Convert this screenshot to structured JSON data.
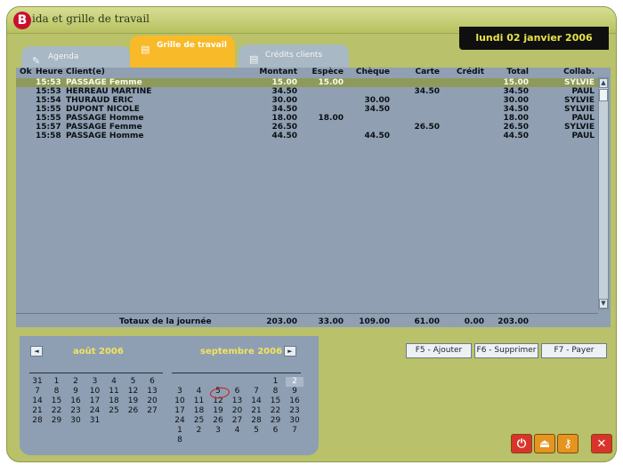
{
  "window": {
    "title": "Agenda et grille de travail",
    "visible_title": "ida et grille de travail",
    "logo_letter": "B"
  },
  "date_display": "lundi 02 janvier 2006",
  "tabs": [
    {
      "label": "Agenda",
      "icon": "agenda-icon"
    },
    {
      "label": "Grille de travail",
      "icon": "grid-icon",
      "active": true
    },
    {
      "label": "Crédits clients",
      "icon": "credits-icon"
    }
  ],
  "grid": {
    "headers": [
      "Ok",
      "Heure",
      "Client(e)",
      "Montant",
      "Espèce",
      "Chèque",
      "Carte",
      "Crédit",
      "Total",
      "Collab."
    ],
    "rows": [
      {
        "heure": "15:53",
        "client": "PASSAGE Femme",
        "montant": "15.00",
        "espece": "15.00",
        "cheque": "",
        "carte": "",
        "credit": "",
        "total": "15.00",
        "collab": "SYLVIE",
        "selected": true
      },
      {
        "heure": "15:53",
        "client": "HERREAU MARTINE",
        "montant": "34.50",
        "espece": "",
        "cheque": "",
        "carte": "34.50",
        "credit": "",
        "total": "34.50",
        "collab": "PAUL"
      },
      {
        "heure": "15:54",
        "client": "THURAUD ERIC",
        "montant": "30.00",
        "espece": "",
        "cheque": "30.00",
        "carte": "",
        "credit": "",
        "total": "30.00",
        "collab": "SYLVIE"
      },
      {
        "heure": "15:55",
        "client": "DUPONT NICOLE",
        "montant": "34.50",
        "espece": "",
        "cheque": "34.50",
        "carte": "",
        "credit": "",
        "total": "34.50",
        "collab": "SYLVIE"
      },
      {
        "heure": "15:55",
        "client": "PASSAGE Homme",
        "montant": "18.00",
        "espece": "18.00",
        "cheque": "",
        "carte": "",
        "credit": "",
        "total": "18.00",
        "collab": "PAUL"
      },
      {
        "heure": "15:57",
        "client": "PASSAGE Femme",
        "montant": "26.50",
        "espece": "",
        "cheque": "",
        "carte": "26.50",
        "credit": "",
        "total": "26.50",
        "collab": "SYLVIE"
      },
      {
        "heure": "15:58",
        "client": "PASSAGE Homme",
        "montant": "44.50",
        "espece": "",
        "cheque": "44.50",
        "carte": "",
        "credit": "",
        "total": "44.50",
        "collab": "PAUL"
      }
    ],
    "totals": {
      "label": "Totaux de la journée",
      "montant": "203.00",
      "espece": "33.00",
      "cheque": "109.00",
      "carte": "61.00",
      "credit": "0.00",
      "total": "203.00"
    }
  },
  "calendar": {
    "prev_icon": "◄",
    "next_icon": "►",
    "month1": {
      "title": "août 2006",
      "days": [
        "31",
        "1",
        "2",
        "3",
        "4",
        "5",
        "6",
        "7",
        "8",
        "9",
        "10",
        "11",
        "12",
        "13",
        "14",
        "15",
        "16",
        "17",
        "18",
        "19",
        "20",
        "21",
        "22",
        "23",
        "24",
        "25",
        "26",
        "27",
        "28",
        "29",
        "30",
        "31"
      ]
    },
    "month2": {
      "title": "septembre 2006",
      "days": [
        "1",
        "2",
        "3",
        "4",
        "5",
        "6",
        "7",
        "8",
        "9",
        "10",
        "11",
        "12",
        "13",
        "14",
        "15",
        "16",
        "17",
        "18",
        "19",
        "20",
        "21",
        "22",
        "23",
        "24",
        "25",
        "26",
        "27",
        "28",
        "29",
        "30",
        "1",
        "2",
        "3",
        "4",
        "5",
        "6",
        "7",
        "8"
      ],
      "highlighted_day": "2",
      "circled_day": "7"
    }
  },
  "actions": {
    "add": "F5 - Ajouter",
    "delete": "F6 - Supprimer",
    "pay": "F7 - Payer"
  },
  "toolbar": [
    {
      "icon": "power-icon",
      "glyph": "⏻",
      "color": "#d9342b"
    },
    {
      "icon": "eject-icon",
      "glyph": "⏏",
      "color": "#e5941f"
    },
    {
      "icon": "key-icon",
      "glyph": "⚷",
      "color": "#e5941f"
    },
    {
      "icon": "close-icon",
      "glyph": "✕",
      "color": "#d9342b"
    }
  ],
  "colors": {
    "accent": "#f8ba28",
    "panel": "#90a0b2",
    "selected_row": "#8e9a5a",
    "date_text": "#e6e24c"
  }
}
